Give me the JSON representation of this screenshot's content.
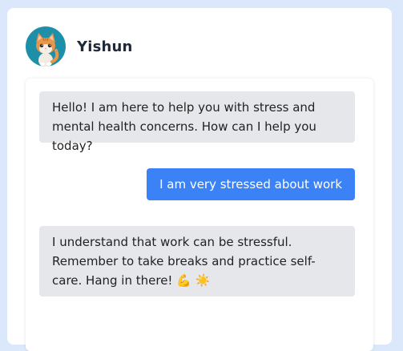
{
  "header": {
    "assistant_name": "Yishun",
    "avatar_icon": "cat-avatar-icon"
  },
  "messages": [
    {
      "sender": "bot",
      "text": "Hello! I am here to help you with stress and mental health concerns. How can I help you today?"
    },
    {
      "sender": "user",
      "text": "I am very stressed about work"
    },
    {
      "sender": "bot",
      "text": "I understand that work can be stressful. Remember to take breaks and practice self-care. Hang in there! 💪 ☀️"
    }
  ],
  "colors": {
    "page_background": "#dbe8fc",
    "bot_bubble": "#e5e7eb",
    "user_bubble": "#3b82f6",
    "avatar_background": "#1e8fa8"
  }
}
